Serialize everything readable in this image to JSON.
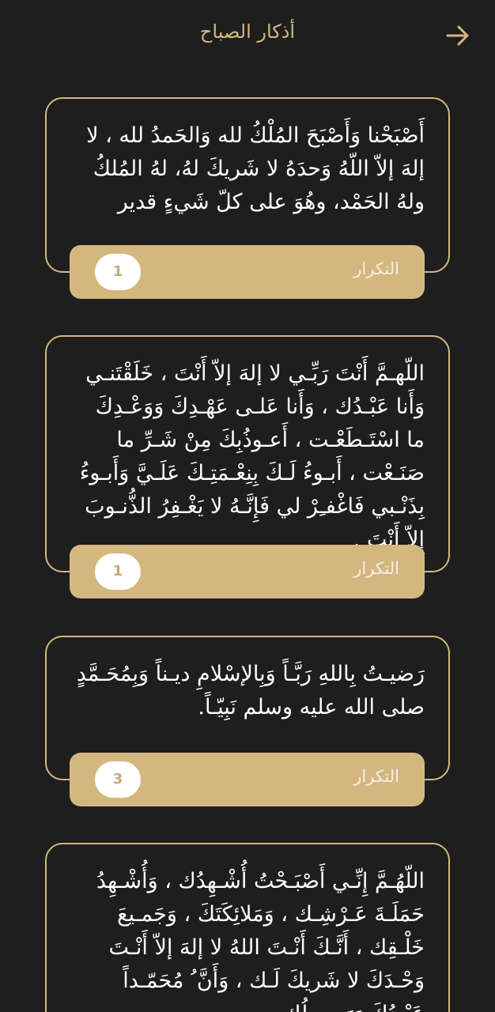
{
  "header": {
    "title": "أذكار الصباح",
    "back_icon": "arrow-right-icon"
  },
  "colors": {
    "background": "#1e1e1e",
    "accent": "#d4b77f",
    "text": "#ffffff"
  },
  "cards": [
    {
      "text": "أَصْبَحْنا وَأَصْبَحَ المُلْكُ لله وَالحَمدُ لله ، لا إلهَ إلاّ اللّهُ وَحدَهُ لا شَريكَ لهُ، لهُ المُلكُ ولهُ الحَمْد، وهُوَ على كلّ شَيءٍ قدير",
      "repeat_label": "التكرار",
      "repeat_count": "1"
    },
    {
      "text": "اللّهـمَّ أَنْتَ رَبِّـي لا إلهَ إلاّ أَنْتَ ، خَلَقْتَنـي وَأَنا عَبْـدُك ، وَأَنا عَلـى عَهْـدِكَ وَوَعْـدِكَ ما اسْتَـطَعْـت ، أَعـوذُبِكَ مِنْ شَـرِّ ما صَنَـعْت ، أَبـوءُ لَـكَ بِنِعْـمَتِـكَ عَلَـيَّ وَأَبـوءُ بِذَنْـبي فَاغْفـِرْ لي فَإِنَّـهُ لا يَغْـفِرُ الذُّنـوبَ إِلاّ أَنْتَ .",
      "repeat_label": "التكرار",
      "repeat_count": "1"
    },
    {
      "text": "رَضيـتُ بِاللهِ رَبَّـاً وَبِالإسْلامِ ديـناً وَبِمُحَـمَّدٍ صلى الله عليه وسلم نَبِيّـاً.",
      "repeat_label": "التكرار",
      "repeat_count": "3"
    },
    {
      "text": "اللّهُـمَّ إِنِّـي أَصْبَـحْتُ أُشْـهِدُك ، وَأُشْـهِدُ حَمَلَـةَ عَـرْشِـك ، وَمَلائِكَتَكَ ، وَجَمـيعَ خَلْـقِك ، أَنَّـكَ أَنْـتَ اللهُ لا إلهَ إلاّ أَنْـتَ وَحْـدَكَ لا شَريكَ لَـك ، وَأَنَّ ُ مُحَمّـداً عَبْـدُكَ وَرَسـولُك.",
      "repeat_label": "",
      "repeat_count": ""
    }
  ]
}
